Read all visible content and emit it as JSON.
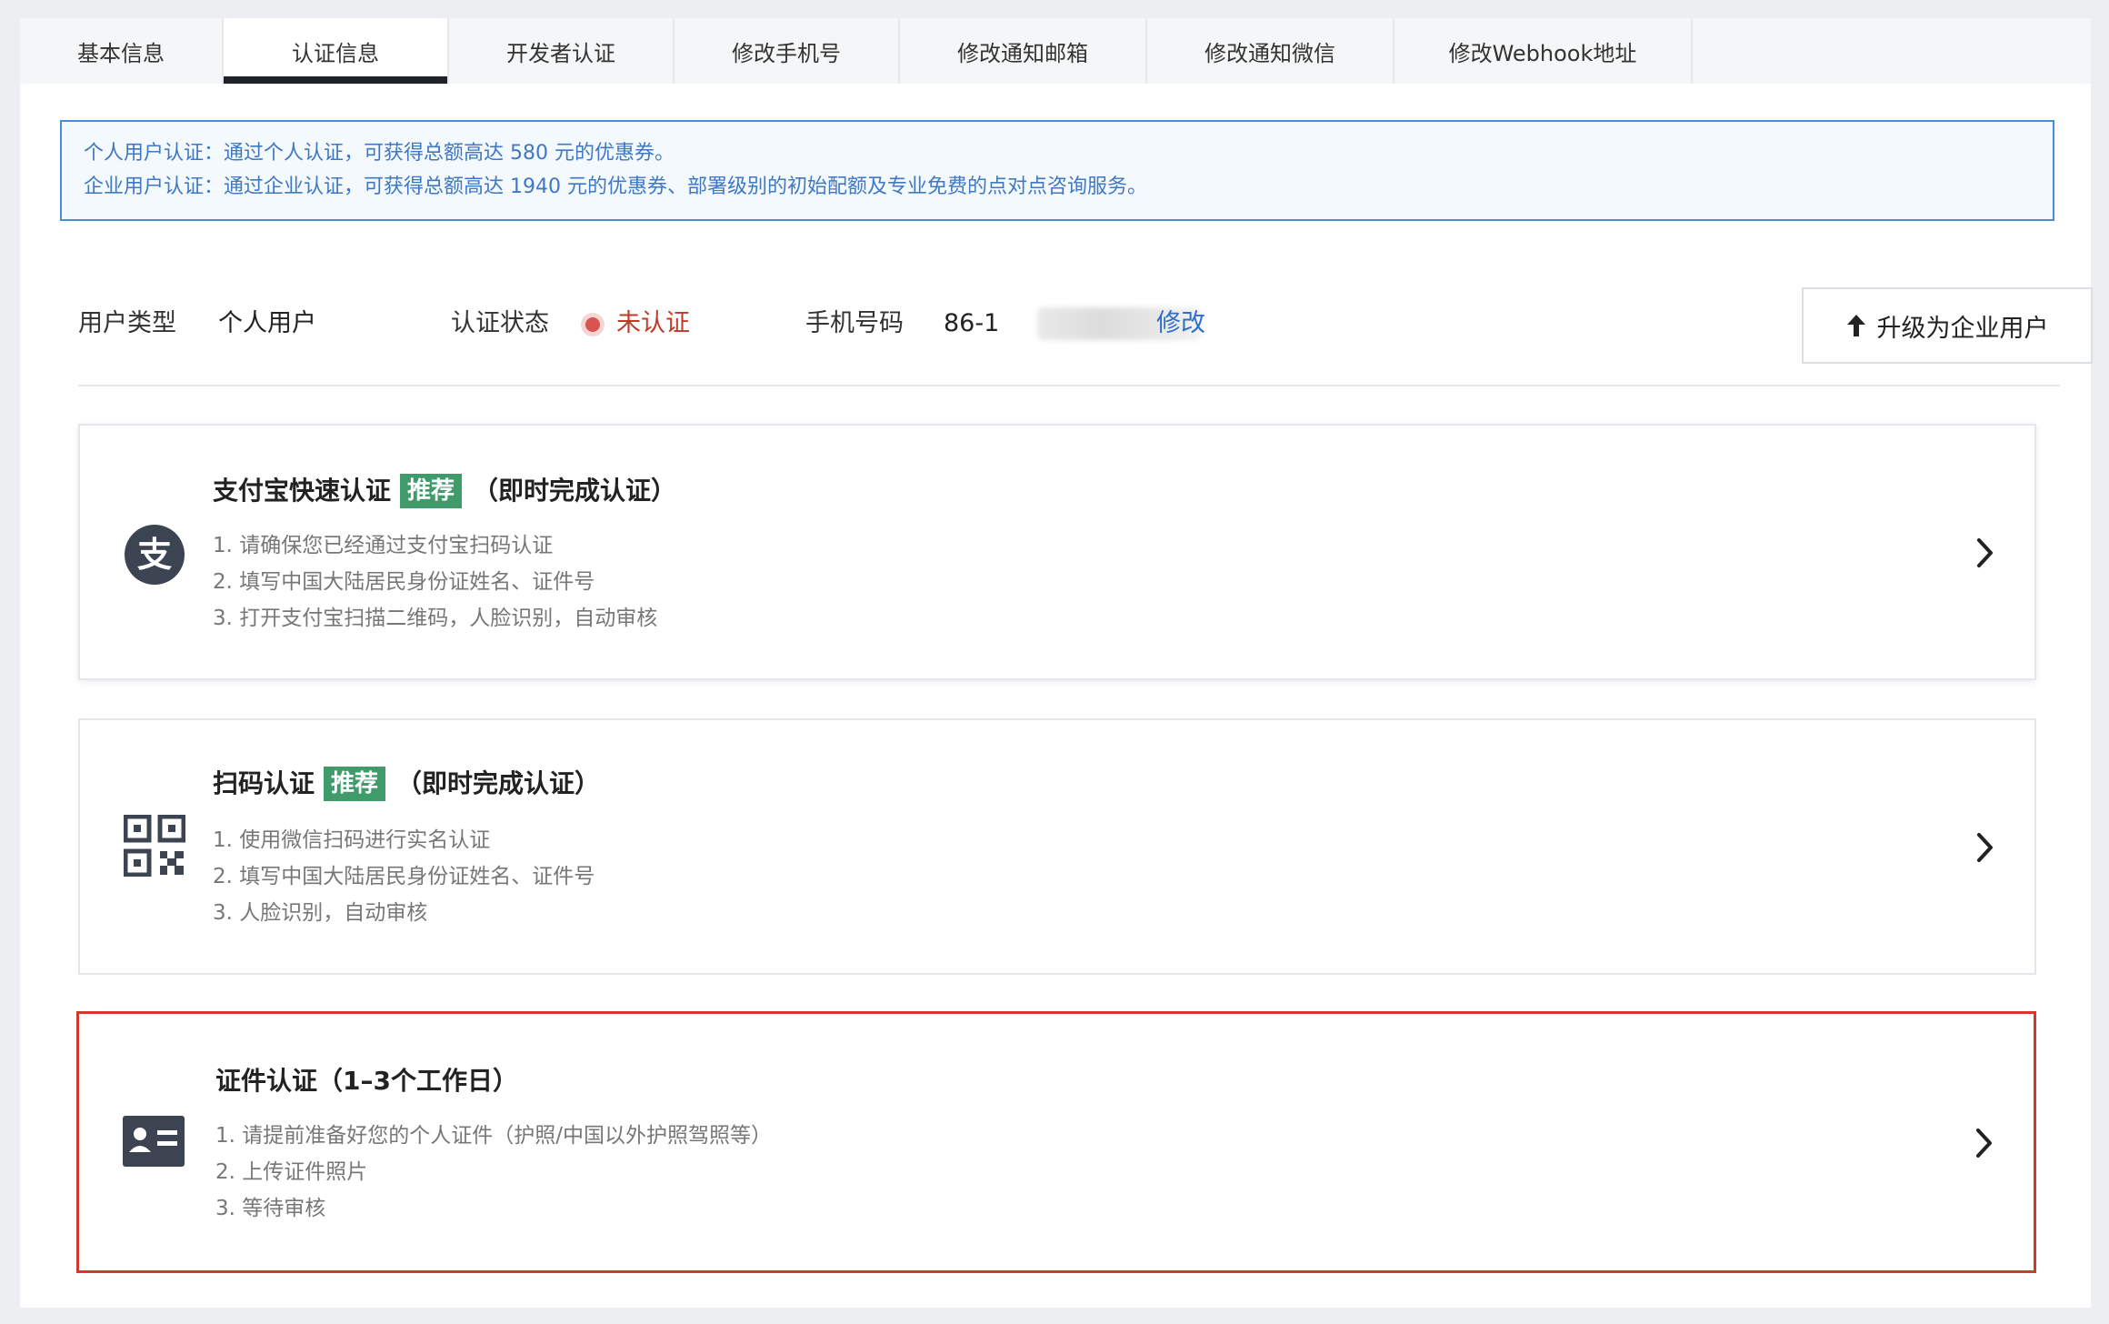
{
  "tabs": [
    {
      "label": "基本信息",
      "active": false
    },
    {
      "label": "认证信息",
      "active": true
    },
    {
      "label": "开发者认证",
      "active": false
    },
    {
      "label": "修改手机号",
      "active": false
    },
    {
      "label": "修改通知邮箱",
      "active": false
    },
    {
      "label": "修改通知微信",
      "active": false
    },
    {
      "label": "修改Webhook地址",
      "active": false
    }
  ],
  "notice": {
    "line1": "个人用户认证：通过个人认证，可获得总额高达 580 元的优惠券。",
    "line2": "企业用户认证：通过企业认证，可获得总额高达 1940 元的优惠券、部署级别的初始配额及专业免费的点对点咨询服务。"
  },
  "info": {
    "user_type_label": "用户类型",
    "user_type_value": "个人用户",
    "status_label": "认证状态",
    "status_value": "未认证",
    "phone_label": "手机号码",
    "phone_value": "86-1",
    "edit_label": "修改",
    "upgrade_label": "升级为企业用户"
  },
  "cards": [
    {
      "title": "支付宝快速认证",
      "tag": "推荐",
      "suffix": "（即时完成认证）",
      "icon": "alipay-icon",
      "steps": [
        "1. 请确保您已经通过支付宝扫码认证",
        "2. 填写中国大陆居民身份证姓名、证件号",
        "3. 打开支付宝扫描二维码，人脸识别，自动审核"
      ]
    },
    {
      "title": "扫码认证",
      "tag": "推荐",
      "suffix": "（即时完成认证）",
      "icon": "qr-code-icon",
      "steps": [
        "1. 使用微信扫码进行实名认证",
        "2. 填写中国大陆居民身份证姓名、证件号",
        "3. 人脸识别，自动审核"
      ]
    },
    {
      "title": "证件认证（1–3个工作日）",
      "icon": "id-card-icon",
      "steps": [
        "1. 请提前准备好您的个人证件（护照/中国以外护照驾照等）",
        "2. 上传证件照片",
        "3. 等待审核"
      ]
    }
  ],
  "colors": {
    "accent_link": "#2f6fc7",
    "status_red": "#c0392b",
    "tag_green": "#3f9b6a",
    "selected_border": "#d0392b"
  }
}
